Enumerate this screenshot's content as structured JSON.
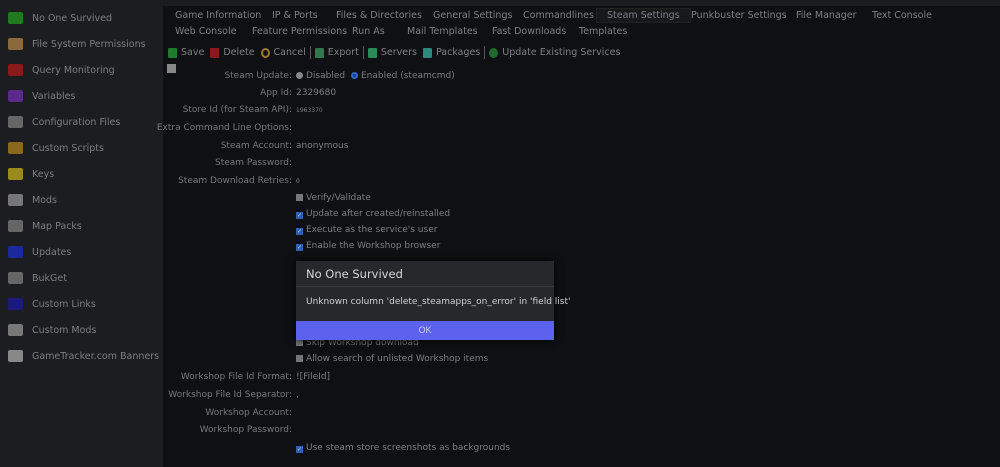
{
  "sidebar": {
    "items": [
      {
        "label": "No One Survived",
        "icon": "server-icon",
        "color": "#1f7a1f"
      },
      {
        "label": "File System Permissions",
        "icon": "folder-icon",
        "color": "#8a6a3a"
      },
      {
        "label": "Query Monitoring",
        "icon": "heart-icon",
        "color": "#8a1a1a"
      },
      {
        "label": "Variables",
        "icon": "shuffle-icon",
        "color": "#5a2a8a"
      },
      {
        "label": "Configuration Files",
        "icon": "sliders-icon",
        "color": "#666"
      },
      {
        "label": "Custom Scripts",
        "icon": "laptop-icon",
        "color": "#8a6a1a"
      },
      {
        "label": "Keys",
        "icon": "key-icon",
        "color": "#9a8a1a"
      },
      {
        "label": "Mods",
        "icon": "flask-icon",
        "color": "#777"
      },
      {
        "label": "Map Packs",
        "icon": "book-icon",
        "color": "#666"
      },
      {
        "label": "Updates",
        "icon": "cloud-download-icon",
        "color": "#1a2a9a"
      },
      {
        "label": "BukGet",
        "icon": "java-icon",
        "color": "#666"
      },
      {
        "label": "Custom Links",
        "icon": "external-link-icon",
        "color": "#1a1a7a"
      },
      {
        "label": "Custom Mods",
        "icon": "hammer-icon",
        "color": "#777"
      },
      {
        "label": "GameTracker.com Banners",
        "icon": "binoculars-icon",
        "color": "#888"
      }
    ]
  },
  "tabs": {
    "row1": [
      "Game Information",
      "IP & Ports",
      "Files & Directories",
      "General Settings",
      "Commandlines",
      "Steam Settings",
      "Punkbuster Settings",
      "File Manager",
      "Text Console"
    ],
    "row2": [
      "Web Console",
      "Feature Permissions",
      "Run As",
      "Mail Templates",
      "Fast Downloads",
      "Templates"
    ],
    "active": "Steam Settings"
  },
  "toolbar": {
    "save": "Save",
    "delete": "Delete",
    "cancel": "Cancel",
    "export": "Export",
    "servers": "Servers",
    "packages": "Packages",
    "update": "Update Existing Services"
  },
  "form": {
    "steam_update_label": "Steam Update:",
    "disabled": "Disabled",
    "enabled": "Enabled (steamcmd)",
    "steam_update_value": "Enabled (steamcmd)",
    "app_id_label": "App Id:",
    "app_id": "2329680",
    "store_id_label": "Store Id (for Steam API):",
    "store_id": "1963370",
    "extra_label": "Extra Command Line Options:",
    "extra": "",
    "account_label": "Steam Account:",
    "account": "anonymous",
    "password_label": "Steam Password:",
    "retries_label": "Steam Download Retries:",
    "retries": "0",
    "checks": [
      {
        "label": "Verify/Validate",
        "checked": false
      },
      {
        "label": "Update after created/reinstalled",
        "checked": true
      },
      {
        "label": "Execute as the service's user",
        "checked": true
      },
      {
        "label": "Enable the Workshop browser",
        "checked": true
      }
    ],
    "checks2": [
      {
        "label": "Skip Workshop download",
        "checked": false
      },
      {
        "label": "Allow search of unlisted Workshop items",
        "checked": false
      }
    ],
    "ws_format_label": "Workshop File Id Format:",
    "ws_format": "![FileId]",
    "ws_sep_label": "Workshop File Id Separator:",
    "ws_sep": ",",
    "ws_account_label": "Workshop Account:",
    "ws_password_label": "Workshop Password:",
    "bg_check": {
      "label": "Use steam store screenshots as backgrounds",
      "checked": true
    }
  },
  "dialog": {
    "title": "No One Survived",
    "message": "Unknown column 'delete_steamapps_on_error' in 'field list'",
    "ok": "OK",
    "ok_color": "#5c62ee"
  }
}
